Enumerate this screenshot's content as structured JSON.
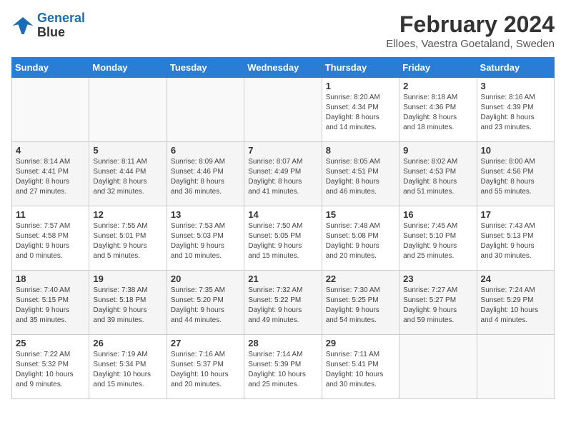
{
  "header": {
    "logo_line1": "General",
    "logo_line2": "Blue",
    "month": "February 2024",
    "location": "Elloes, Vaestra Goetaland, Sweden"
  },
  "weekdays": [
    "Sunday",
    "Monday",
    "Tuesday",
    "Wednesday",
    "Thursday",
    "Friday",
    "Saturday"
  ],
  "weeks": [
    [
      {
        "day": "",
        "info": ""
      },
      {
        "day": "",
        "info": ""
      },
      {
        "day": "",
        "info": ""
      },
      {
        "day": "",
        "info": ""
      },
      {
        "day": "1",
        "info": "Sunrise: 8:20 AM\nSunset: 4:34 PM\nDaylight: 8 hours\nand 14 minutes."
      },
      {
        "day": "2",
        "info": "Sunrise: 8:18 AM\nSunset: 4:36 PM\nDaylight: 8 hours\nand 18 minutes."
      },
      {
        "day": "3",
        "info": "Sunrise: 8:16 AM\nSunset: 4:39 PM\nDaylight: 8 hours\nand 23 minutes."
      }
    ],
    [
      {
        "day": "4",
        "info": "Sunrise: 8:14 AM\nSunset: 4:41 PM\nDaylight: 8 hours\nand 27 minutes."
      },
      {
        "day": "5",
        "info": "Sunrise: 8:11 AM\nSunset: 4:44 PM\nDaylight: 8 hours\nand 32 minutes."
      },
      {
        "day": "6",
        "info": "Sunrise: 8:09 AM\nSunset: 4:46 PM\nDaylight: 8 hours\nand 36 minutes."
      },
      {
        "day": "7",
        "info": "Sunrise: 8:07 AM\nSunset: 4:49 PM\nDaylight: 8 hours\nand 41 minutes."
      },
      {
        "day": "8",
        "info": "Sunrise: 8:05 AM\nSunset: 4:51 PM\nDaylight: 8 hours\nand 46 minutes."
      },
      {
        "day": "9",
        "info": "Sunrise: 8:02 AM\nSunset: 4:53 PM\nDaylight: 8 hours\nand 51 minutes."
      },
      {
        "day": "10",
        "info": "Sunrise: 8:00 AM\nSunset: 4:56 PM\nDaylight: 8 hours\nand 55 minutes."
      }
    ],
    [
      {
        "day": "11",
        "info": "Sunrise: 7:57 AM\nSunset: 4:58 PM\nDaylight: 9 hours\nand 0 minutes."
      },
      {
        "day": "12",
        "info": "Sunrise: 7:55 AM\nSunset: 5:01 PM\nDaylight: 9 hours\nand 5 minutes."
      },
      {
        "day": "13",
        "info": "Sunrise: 7:53 AM\nSunset: 5:03 PM\nDaylight: 9 hours\nand 10 minutes."
      },
      {
        "day": "14",
        "info": "Sunrise: 7:50 AM\nSunset: 5:05 PM\nDaylight: 9 hours\nand 15 minutes."
      },
      {
        "day": "15",
        "info": "Sunrise: 7:48 AM\nSunset: 5:08 PM\nDaylight: 9 hours\nand 20 minutes."
      },
      {
        "day": "16",
        "info": "Sunrise: 7:45 AM\nSunset: 5:10 PM\nDaylight: 9 hours\nand 25 minutes."
      },
      {
        "day": "17",
        "info": "Sunrise: 7:43 AM\nSunset: 5:13 PM\nDaylight: 9 hours\nand 30 minutes."
      }
    ],
    [
      {
        "day": "18",
        "info": "Sunrise: 7:40 AM\nSunset: 5:15 PM\nDaylight: 9 hours\nand 35 minutes."
      },
      {
        "day": "19",
        "info": "Sunrise: 7:38 AM\nSunset: 5:18 PM\nDaylight: 9 hours\nand 39 minutes."
      },
      {
        "day": "20",
        "info": "Sunrise: 7:35 AM\nSunset: 5:20 PM\nDaylight: 9 hours\nand 44 minutes."
      },
      {
        "day": "21",
        "info": "Sunrise: 7:32 AM\nSunset: 5:22 PM\nDaylight: 9 hours\nand 49 minutes."
      },
      {
        "day": "22",
        "info": "Sunrise: 7:30 AM\nSunset: 5:25 PM\nDaylight: 9 hours\nand 54 minutes."
      },
      {
        "day": "23",
        "info": "Sunrise: 7:27 AM\nSunset: 5:27 PM\nDaylight: 9 hours\nand 59 minutes."
      },
      {
        "day": "24",
        "info": "Sunrise: 7:24 AM\nSunset: 5:29 PM\nDaylight: 10 hours\nand 4 minutes."
      }
    ],
    [
      {
        "day": "25",
        "info": "Sunrise: 7:22 AM\nSunset: 5:32 PM\nDaylight: 10 hours\nand 9 minutes."
      },
      {
        "day": "26",
        "info": "Sunrise: 7:19 AM\nSunset: 5:34 PM\nDaylight: 10 hours\nand 15 minutes."
      },
      {
        "day": "27",
        "info": "Sunrise: 7:16 AM\nSunset: 5:37 PM\nDaylight: 10 hours\nand 20 minutes."
      },
      {
        "day": "28",
        "info": "Sunrise: 7:14 AM\nSunset: 5:39 PM\nDaylight: 10 hours\nand 25 minutes."
      },
      {
        "day": "29",
        "info": "Sunrise: 7:11 AM\nSunset: 5:41 PM\nDaylight: 10 hours\nand 30 minutes."
      },
      {
        "day": "",
        "info": ""
      },
      {
        "day": "",
        "info": ""
      }
    ]
  ]
}
